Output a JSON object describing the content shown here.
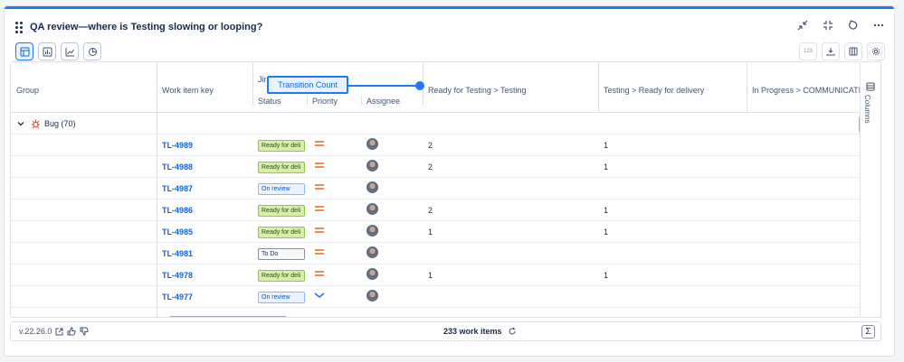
{
  "title": "QA review—where is Testing slowing or looping?",
  "header": {
    "group": "Group",
    "work_item_key": "Work item key",
    "jira_partial": "Jir",
    "status": "Status",
    "priority": "Priority",
    "assignee": "Assignee",
    "col1": "Ready for Testing > Testing",
    "col2": "Testing > Ready for delivery",
    "col3": "In Progress > COMMUNICATION"
  },
  "transition_count_label": "Transition Count",
  "toolbar": {
    "count_label": "123"
  },
  "group_row": {
    "label": "Bug (70)"
  },
  "rows": [
    {
      "key": "TL-4989",
      "status": "Ready for deli",
      "status_kind": "green2",
      "priority": "medium",
      "c1": "2",
      "c2": "1"
    },
    {
      "key": "TL-4988",
      "status": "Ready for deli",
      "status_kind": "green2",
      "priority": "medium",
      "c1": "2",
      "c2": "1"
    },
    {
      "key": "TL-4987",
      "status": "On review",
      "status_kind": "blue",
      "priority": "medium",
      "c1": "",
      "c2": ""
    },
    {
      "key": "TL-4986",
      "status": "Ready for deli",
      "status_kind": "green2",
      "priority": "medium",
      "c1": "2",
      "c2": "1"
    },
    {
      "key": "TL-4985",
      "status": "Ready for deli",
      "status_kind": "green2",
      "priority": "medium",
      "c1": "1",
      "c2": "1"
    },
    {
      "key": "TL-4981",
      "status": "To Do",
      "status_kind": "gray",
      "priority": "medium",
      "c1": "",
      "c2": ""
    },
    {
      "key": "TL-4978",
      "status": "Ready for deli",
      "status_kind": "green2",
      "priority": "medium",
      "c1": "1",
      "c2": "1"
    },
    {
      "key": "TL-4977",
      "status": "On review",
      "status_kind": "blue",
      "priority": "low",
      "c1": "",
      "c2": ""
    }
  ],
  "columns_label": "Columns",
  "footer": {
    "version": "v.22.26.0",
    "work_items": "233 work items"
  },
  "colors": {
    "accent": "#1d7afc",
    "link": "#0c66e4",
    "priority_medium": "#e56910",
    "priority_low": "#1d7afc",
    "bug": "#e2483d"
  }
}
